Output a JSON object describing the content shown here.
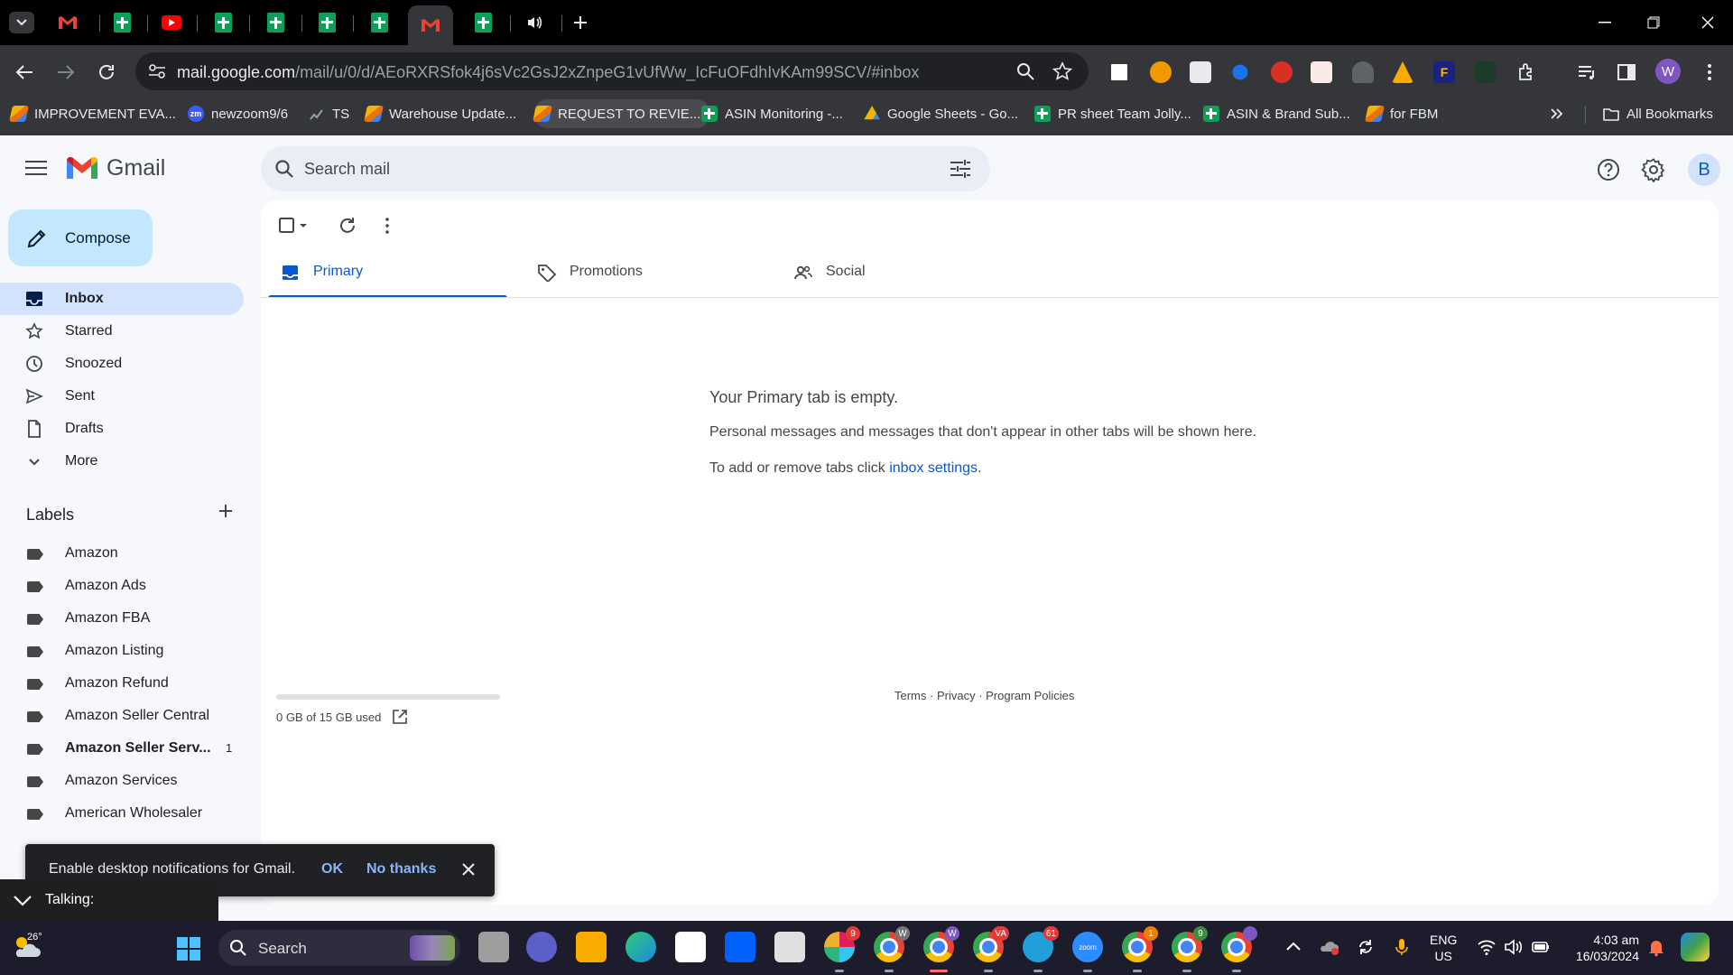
{
  "browser": {
    "url_host": "mail.google.com",
    "url_path": "/mail/u/0/d/AEoRXRSfok4j6sVc2GsJ2xZnpeG1vUfWw_IcFuOFdhIvKAm99SCV/#inbox",
    "bookmarks": [
      {
        "label": "IMPROVEMENT EVA...",
        "icon": "orange"
      },
      {
        "label": "newzoom9/6",
        "icon": "zm"
      },
      {
        "label": "TS",
        "icon": "chart"
      },
      {
        "label": "Warehouse Update...",
        "icon": "orange"
      },
      {
        "label": "REQUEST TO REVIE...",
        "icon": "orange"
      },
      {
        "label": "ASIN Monitoring -...",
        "icon": "sheets"
      },
      {
        "label": "Google Sheets - Go...",
        "icon": "drive"
      },
      {
        "label": "PR sheet Team Jolly...",
        "icon": "sheets"
      },
      {
        "label": "ASIN & Brand Sub...",
        "icon": "sheets"
      },
      {
        "label": "for FBM",
        "icon": "orange"
      }
    ],
    "all_bookmarks_label": "All Bookmarks",
    "profile_initial": "W"
  },
  "gmail": {
    "app_name": "Gmail",
    "search_placeholder": "Search mail",
    "avatar_initial": "B",
    "compose_label": "Compose",
    "nav": [
      {
        "label": "Inbox",
        "icon": "inbox-icon",
        "active": true
      },
      {
        "label": "Starred",
        "icon": "star-icon"
      },
      {
        "label": "Snoozed",
        "icon": "clock-icon"
      },
      {
        "label": "Sent",
        "icon": "send-icon"
      },
      {
        "label": "Drafts",
        "icon": "draft-icon"
      },
      {
        "label": "More",
        "icon": "chevron-down-icon"
      }
    ],
    "labels_heading": "Labels",
    "labels": [
      {
        "label": "Amazon"
      },
      {
        "label": "Amazon Ads"
      },
      {
        "label": "Amazon FBA"
      },
      {
        "label": "Amazon Listing"
      },
      {
        "label": "Amazon Refund"
      },
      {
        "label": "Amazon Seller Central"
      },
      {
        "label": "Amazon Seller Serv...",
        "count": "1",
        "bold": true
      },
      {
        "label": "Amazon Services"
      },
      {
        "label": "American Wholesaler"
      }
    ],
    "tabs": [
      {
        "label": "Primary",
        "icon": "inbox-tab-icon",
        "active": true
      },
      {
        "label": "Promotions",
        "icon": "tag-icon"
      },
      {
        "label": "Social",
        "icon": "people-icon"
      }
    ],
    "empty": {
      "title": "Your Primary tab is empty.",
      "description": "Personal messages and messages that don't appear in other tabs will be shown here.",
      "hint_prefix": "To add or remove tabs click ",
      "hint_link": "inbox settings",
      "hint_suffix": "."
    },
    "storage": "0 GB of 15 GB used",
    "footer": {
      "terms": "Terms",
      "privacy": "Privacy",
      "policies": "Program Policies",
      "sep": " · "
    },
    "snackbar": {
      "message": "Enable desktop notifications for Gmail.",
      "ok": "OK",
      "no_thanks": "No thanks"
    }
  },
  "overlay": {
    "talking": "Talking:"
  },
  "taskbar": {
    "temperature": "26°",
    "search_label": "Search",
    "badges": {
      "slack": "9",
      "chrome_w": "W",
      "chrome_active": "W",
      "chrome_va": "VA",
      "telegram": "61",
      "chrome_1": "1",
      "chrome_9": "9"
    },
    "lang_line1": "ENG",
    "lang_line2": "US",
    "time": "4:03 am",
    "date": "16/03/2024"
  },
  "colors": {
    "accent": "#0b57d0",
    "compose": "#c2e7ff",
    "active_nav": "#d3e3fd",
    "page_bg": "#f6f8fc"
  }
}
